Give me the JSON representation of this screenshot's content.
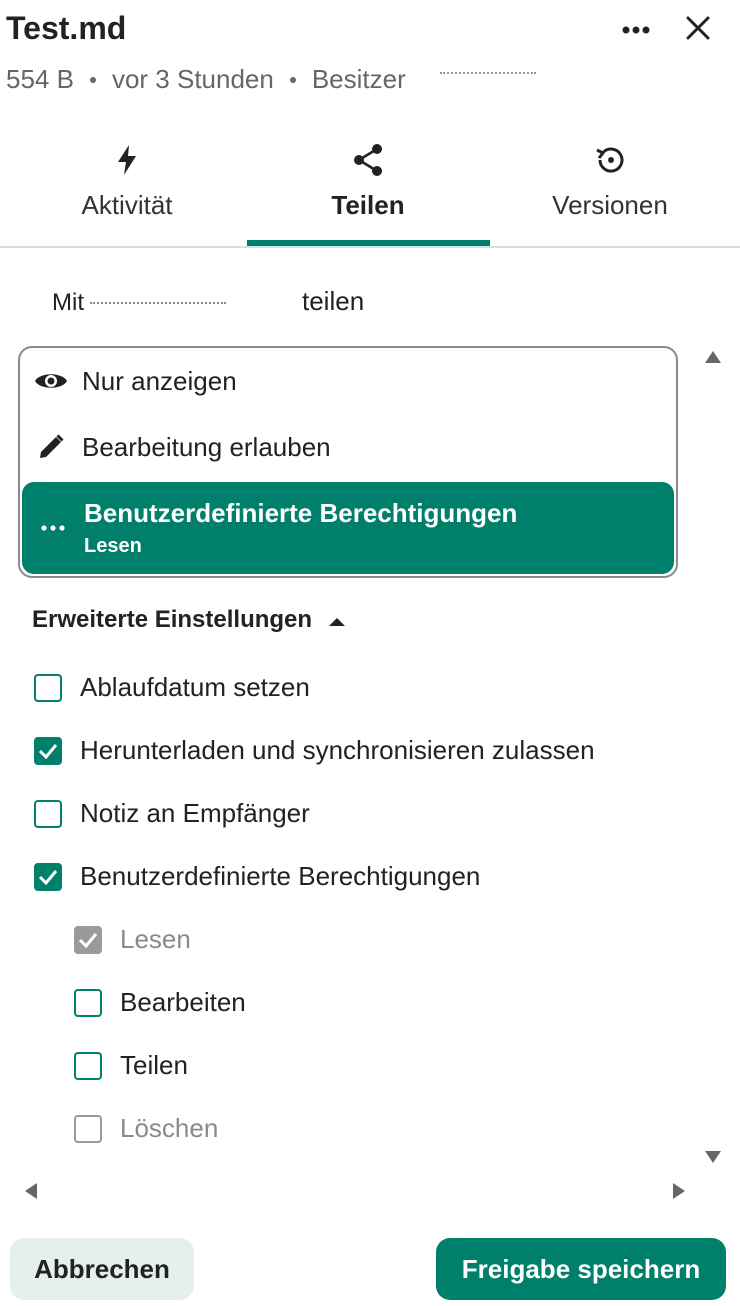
{
  "header": {
    "title": "Test.md",
    "size": "554 B",
    "modified": "vor 3 Stunden",
    "owner_label": "Besitzer",
    "more_icon": "more-horizontal-icon",
    "close_icon": "close-icon"
  },
  "tabs": [
    {
      "label": "Aktivität",
      "icon": "lightning-icon",
      "active": false
    },
    {
      "label": "Teilen",
      "icon": "share-icon",
      "active": true
    },
    {
      "label": "Versionen",
      "icon": "history-icon",
      "active": false
    }
  ],
  "share": {
    "prefix": "Mit",
    "suffix": "teilen"
  },
  "permissions_dropdown": {
    "options": [
      {
        "label": "Nur anzeigen",
        "icon": "eye-icon"
      },
      {
        "label": "Bearbeitung erlauben",
        "icon": "pencil-icon"
      },
      {
        "label": "Benutzerdefinierte Berechtigungen",
        "sublabel": "Lesen",
        "icon": "dots-icon",
        "selected": true
      }
    ]
  },
  "advanced": {
    "label": "Erweiterte Einstellungen",
    "icon": "caret-up-icon",
    "checkboxes": [
      {
        "label": "Ablaufdatum setzen",
        "checked": false
      },
      {
        "label": "Herunterladen und synchronisieren zulassen",
        "checked": true
      },
      {
        "label": "Notiz an Empfänger",
        "checked": false
      },
      {
        "label": "Benutzerdefinierte Berechtigungen",
        "checked": true
      }
    ],
    "custom_permissions": [
      {
        "label": "Lesen",
        "checked": true,
        "disabled": true
      },
      {
        "label": "Bearbeiten",
        "checked": false,
        "disabled": false
      },
      {
        "label": "Teilen",
        "checked": false,
        "disabled": false
      },
      {
        "label": "Löschen",
        "checked": false,
        "disabled": true
      }
    ]
  },
  "footer": {
    "cancel_label": "Abbrechen",
    "save_label": "Freigabe speichern"
  },
  "colors": {
    "accent": "#00806b",
    "cancel_bg": "#e5efed",
    "muted": "#8a8a8a"
  }
}
